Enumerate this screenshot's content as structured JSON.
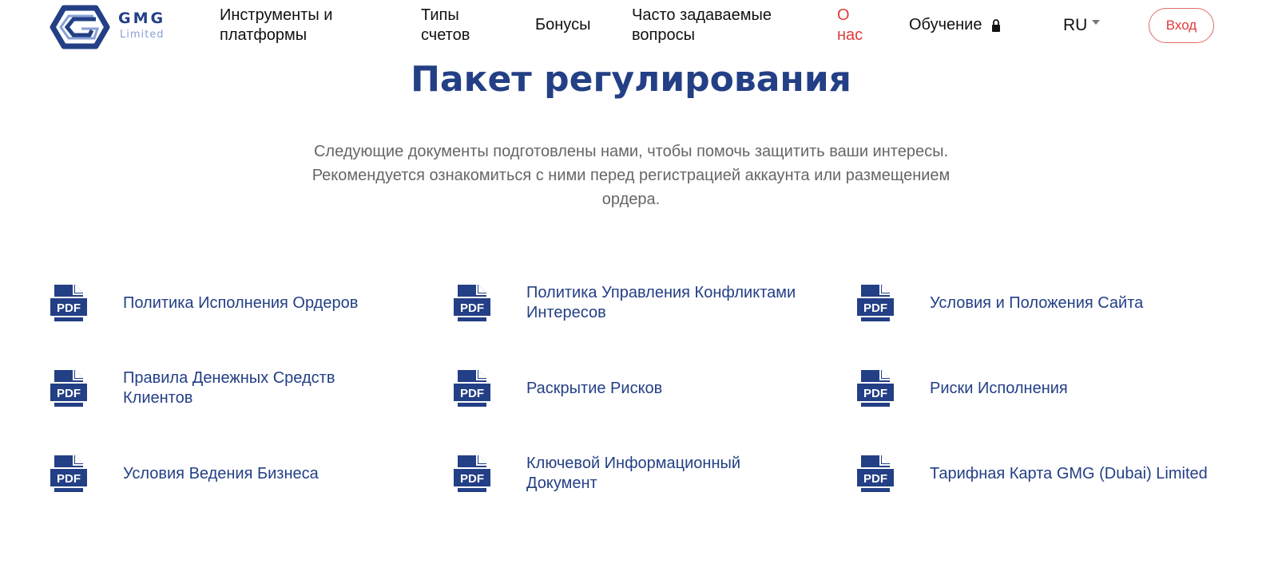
{
  "header": {
    "logo": {
      "main": "GMG",
      "sub": "Limited"
    },
    "nav": {
      "tools": "Инструменты и платформы",
      "types": "Типы счетов",
      "bonus": "Бонусы",
      "faq": "Часто задаваемые вопросы",
      "about": "О нас",
      "education": "Обучение"
    },
    "lang": "RU",
    "login": "Вход"
  },
  "main": {
    "title": "Пакет регулирования",
    "intro": "Следующие документы подготовлены нами, чтобы помочь защитить ваши интересы. Рекомендуется ознакомиться с ними перед регистрацией аккаунта или размещением ордера.",
    "documents": [
      {
        "label": "Политика Исполнения Ордеров",
        "icon": "pdf-icon"
      },
      {
        "label": "Политика Управления Конфликтами Интересов",
        "icon": "pdf-icon"
      },
      {
        "label": "Условия и Положения Сайта",
        "icon": "pdf-icon"
      },
      {
        "label": "Правила Денежных Средств Клиентов",
        "icon": "pdf-icon"
      },
      {
        "label": "Раскрытие Рисков",
        "icon": "pdf-icon"
      },
      {
        "label": "Риски Исполнения",
        "icon": "pdf-icon"
      },
      {
        "label": "Условия Ведения Бизнеса",
        "icon": "pdf-icon"
      },
      {
        "label": "Ключевой Информационный Документ",
        "icon": "pdf-icon"
      },
      {
        "label": "Тарифная Карта GMG (Dubai) Limited",
        "icon": "pdf-icon"
      }
    ],
    "pdf_badge": "PDF"
  },
  "colors": {
    "brand": "#233f85",
    "accent": "#e03b3b",
    "muted": "#666666"
  }
}
